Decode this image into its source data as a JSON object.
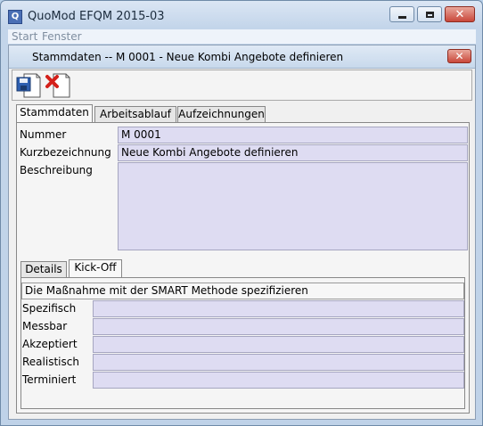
{
  "window": {
    "title": "QuoMod EFQM 2015-03",
    "app_icon_letter": "Q"
  },
  "menu": {
    "items": [
      "Start",
      "Fenster"
    ]
  },
  "inner_window": {
    "title": "Stammdaten -- M 0001 - Neue Kombi Angebote definieren"
  },
  "toolbar": {
    "buttons": [
      "save",
      "delete"
    ]
  },
  "main_tabs": {
    "items": [
      "Stammdaten",
      "Arbeitsablauf",
      "Aufzeichnungen"
    ],
    "active": "Stammdaten"
  },
  "form": {
    "nummer_label": "Nummer",
    "nummer_value": "M 0001",
    "kurz_label": "Kurzbezeichnung",
    "kurz_value": "Neue Kombi Angebote definieren",
    "beschreibung_label": "Beschreibung",
    "beschreibung_value": ""
  },
  "sub_tabs": {
    "items": [
      "Details",
      "Kick-Off"
    ],
    "active": "Kick-Off"
  },
  "smart": {
    "header": "Die Maßnahme mit der SMART Methode spezifizieren",
    "rows": [
      {
        "label": "Spezifisch",
        "value": ""
      },
      {
        "label": "Messbar",
        "value": ""
      },
      {
        "label": "Akzeptiert",
        "value": ""
      },
      {
        "label": "Realistisch",
        "value": ""
      },
      {
        "label": "Terminiert",
        "value": ""
      }
    ]
  },
  "colors": {
    "field_fill": "#dedcf2",
    "close_red": "#c9473a",
    "titlebar": "#c3d5ea"
  }
}
